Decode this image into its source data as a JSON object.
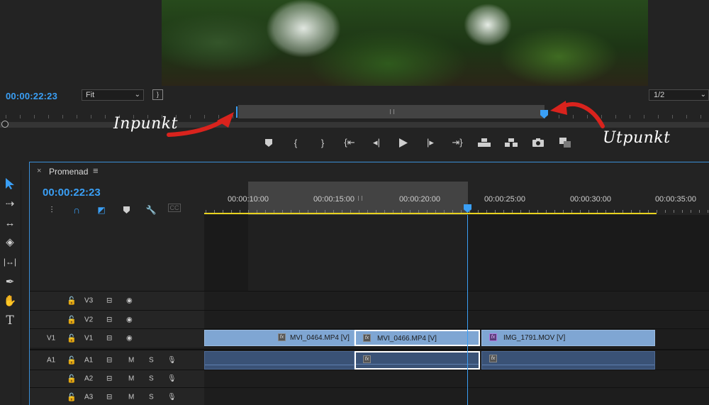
{
  "program_monitor": {
    "timecode": "00:00:22:23",
    "zoom": "Fit",
    "resolution": "1/2",
    "settings_icon": "settings-wrench-icon",
    "transport_buttons": [
      {
        "name": "add-marker-button",
        "icon": "marker-icon"
      },
      {
        "name": "mark-in-button",
        "icon": "mark-in-icon"
      },
      {
        "name": "mark-out-button",
        "icon": "mark-out-icon"
      },
      {
        "name": "go-to-in-button",
        "icon": "go-to-in-icon"
      },
      {
        "name": "step-back-button",
        "icon": "step-back-icon"
      },
      {
        "name": "play-button",
        "icon": "play-icon"
      },
      {
        "name": "step-forward-button",
        "icon": "step-forward-icon"
      },
      {
        "name": "go-to-out-button",
        "icon": "go-to-out-icon"
      },
      {
        "name": "lift-button",
        "icon": "lift-icon"
      },
      {
        "name": "extract-button",
        "icon": "extract-icon"
      },
      {
        "name": "export-frame-button",
        "icon": "camera-icon"
      },
      {
        "name": "comparison-view-button",
        "icon": "comparison-icon"
      }
    ]
  },
  "annotations": {
    "in_point_label": "Inpunkt",
    "out_point_label": "Utpunkt",
    "arrow_color": "#d9231d"
  },
  "tools": [
    "selection-tool-icon",
    "track-select-tool-icon",
    "ripple-edit-tool-icon",
    "razor-tool-icon",
    "slip-tool-icon",
    "pen-tool-icon",
    "hand-tool-icon",
    "type-tool-icon"
  ],
  "timeline": {
    "sequence_name": "Promenad",
    "timecode": "00:00:22:23",
    "header_tools": [
      "nest-icon",
      "snap-magnet-icon",
      "linked-selection-icon",
      "add-marker-icon",
      "settings-wrench-icon",
      "captions-icon"
    ],
    "captions_label": "CC",
    "ruler_labels": [
      "00:00:10:00",
      "00:00:15:00",
      "00:00:20:00",
      "00:00:25:00",
      "00:00:30:00",
      "00:00:35:00"
    ],
    "video_tracks": [
      {
        "source": "",
        "name": "V3"
      },
      {
        "source": "",
        "name": "V2"
      },
      {
        "source": "V1",
        "name": "V1"
      }
    ],
    "audio_tracks": [
      {
        "source": "A1",
        "name": "A1",
        "mute": "M",
        "solo": "S"
      },
      {
        "source": "",
        "name": "A2",
        "mute": "M",
        "solo": "S"
      },
      {
        "source": "",
        "name": "A3",
        "mute": "M",
        "solo": "S"
      }
    ],
    "clips": [
      {
        "name": "MVI_0464.MP4 [V]",
        "fx_color": "gray"
      },
      {
        "name": "MVI_0466.MP4 [V]",
        "fx_color": "gray"
      },
      {
        "name": "IMG_1791.MOV [V]",
        "fx_color": "purple"
      }
    ],
    "colors": {
      "playhead": "#3a9ff5",
      "video_clip": "#7fa6d3",
      "audio_clip": "#3a5276",
      "work_area": "#e8d21f"
    }
  }
}
